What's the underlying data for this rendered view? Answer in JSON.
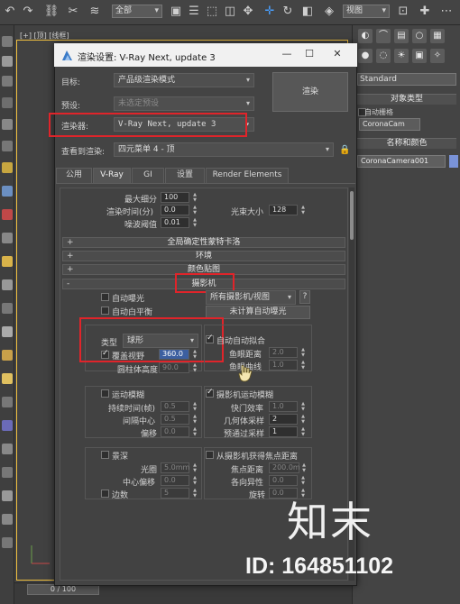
{
  "toolbar": {
    "selection_filter": "全部",
    "view_dropdown": "视图"
  },
  "viewport": {
    "label": "[+] [顶] [线框]"
  },
  "timeline": {
    "frame": "0 / 100"
  },
  "command_panel": {
    "category_dropdown": "Standard",
    "object_type_header": "对象类型",
    "auto_grid_label": "自动栅格",
    "corona_cam_button": "CoronaCam",
    "name_color_header": "名称和颜色",
    "object_name": "CoronaCamera001"
  },
  "dialog": {
    "title": "渲染设置: V-Ray Next, update 3",
    "minimize": "—",
    "maximize": "☐",
    "close": "✕",
    "target_label": "目标:",
    "target_value": "产品级渲染模式",
    "preset_label": "预设:",
    "preset_value": "未选定预设",
    "renderer_label": "渲染器:",
    "renderer_value": "V-Ray Next, update 3",
    "render_button": "渲染",
    "view_label": "查看到渲染:",
    "view_value": "四元菜单 4 - 顶",
    "tabs": [
      "公用",
      "V-Ray",
      "GI",
      "设置",
      "Render Elements"
    ],
    "active_tab": "V-Ray"
  },
  "sampler": {
    "max_subdivs_label": "最大细分",
    "max_subdivs_value": "100",
    "render_time_label": "渲染时间(分)",
    "render_time_value": "0.0",
    "noise_threshold_label": "噪波阈值",
    "noise_threshold_value": "0.01",
    "bundle_size_label": "光束大小",
    "bundle_size_value": "128"
  },
  "rollouts": {
    "global_dmc": "全局确定性蒙特卡洛",
    "environment": "环境",
    "color_mapping": "颜色贴图",
    "camera": "摄影机",
    "plus": "+",
    "minus": "-"
  },
  "camera": {
    "auto_exposure_label": "自动曝光",
    "auto_wb_label": "自动白平衡",
    "camera_list": "所有摄影机/视图",
    "help_button": "?",
    "calc_exposure_button": "未计算自动曝光",
    "type_label": "类型",
    "type_value": "球形",
    "fov_override_label": "覆盖视野",
    "fov_value": "360.0",
    "cylinder_height_label": "圆柱体高度",
    "cylinder_height_value": "90.0",
    "auto_fit_label": "自动自动拟合",
    "fisheye_dist_label": "鱼眼距离",
    "fisheye_dist_value": "2.0",
    "fisheye_curve_label": "鱼眼曲线",
    "fisheye_curve_value": "1.0",
    "motion_blur_label": "运动模糊",
    "duration_label": "持续时间(帧)",
    "duration_value": "0.5",
    "interval_center_label": "间隔中心",
    "interval_center_value": "0.5",
    "bias_label": "偏移",
    "bias_value": "0.0",
    "cam_motion_blur_label": "摄影机运动模糊",
    "shutter_eff_label": "快门效率",
    "shutter_eff_value": "1.0",
    "geo_samples_label": "几何体采样",
    "geo_samples_value": "2",
    "prepass_samples_label": "预通过采样",
    "prepass_samples_value": "1",
    "dof_label": "景深",
    "aperture_label": "光圈",
    "aperture_value": "5.0mm",
    "center_bias_label": "中心偏移",
    "center_bias_value": "0.0",
    "sides_label": "边数",
    "sides_value": "5",
    "from_cam_focus_label": "从摄影机获得焦点距离",
    "focus_dist_label": "焦点距离",
    "focus_dist_value": "200.0m",
    "anisotropy_label": "各向异性",
    "anisotropy_value": "0.0",
    "rotation_label": "旋转",
    "rotation_value": "0.0"
  },
  "watermark": {
    "brand": "知末",
    "id": "ID: 164851102"
  },
  "colors": {
    "highlight_red": "#e0242a",
    "selection_blue": "#3c5fa0",
    "viewport_border": "#f0c040"
  }
}
